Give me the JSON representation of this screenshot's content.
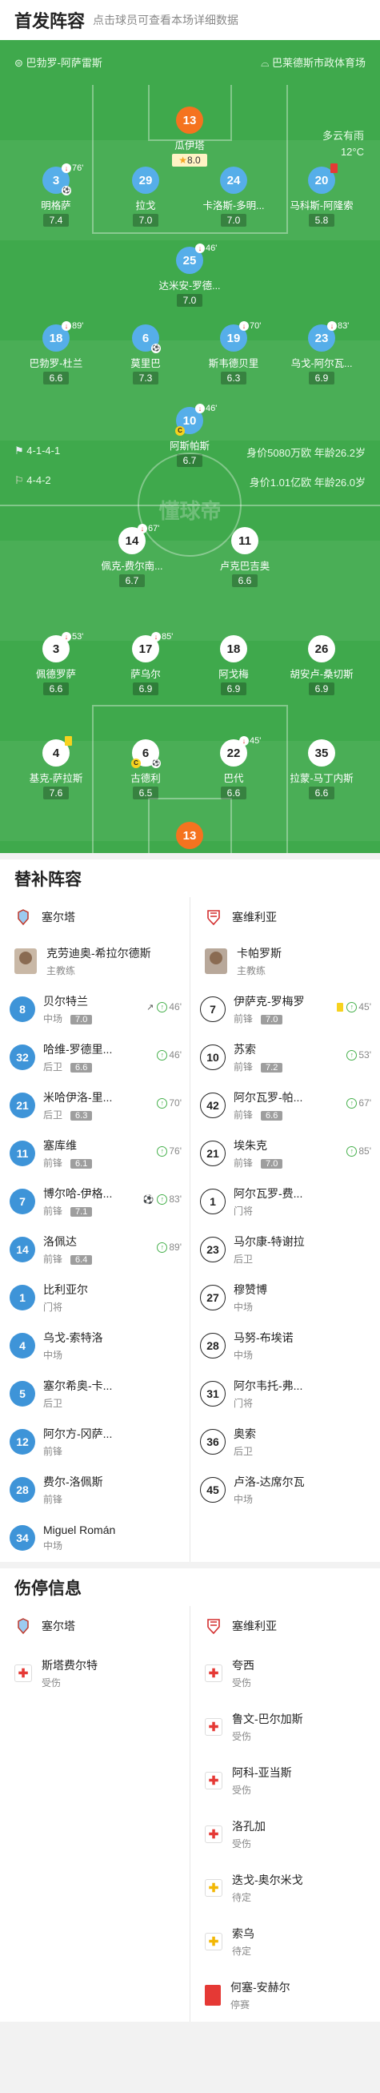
{
  "header": {
    "title": "首发阵容",
    "subtitle": "点击球员可查看本场详细数据"
  },
  "pitch": {
    "home_team": "巴勃罗-阿萨雷斯",
    "away_team": "巴莱德斯市政体育场",
    "weather": "多云有雨",
    "temperature": "12°C",
    "watermark": "懂球帝",
    "home_formation": "4-1-4-1",
    "home_value": "身价5080万欧 年龄26.2岁",
    "away_formation": "4-4-2",
    "away_value": "身价1.01亿欧 年龄26.0岁"
  },
  "home_players": [
    {
      "num": "13",
      "name": "瓜伊塔",
      "rating": "8.0",
      "star": true
    },
    {
      "num": "3",
      "name": "明格萨",
      "rating": "7.4",
      "sub": "76'"
    },
    {
      "num": "29",
      "name": "拉戈",
      "rating": "7.0"
    },
    {
      "num": "24",
      "name": "卡洛斯-多明...",
      "rating": "7.0"
    },
    {
      "num": "20",
      "name": "马科斯-阿隆索",
      "rating": "5.8"
    },
    {
      "num": "25",
      "name": "达米安-罗德...",
      "rating": "7.0",
      "sub": "46'"
    },
    {
      "num": "18",
      "name": "巴勃罗-杜兰",
      "rating": "6.6",
      "sub": "89'"
    },
    {
      "num": "6",
      "name": "莫里巴",
      "rating": "7.3"
    },
    {
      "num": "19",
      "name": "斯韦德贝里",
      "rating": "6.3",
      "sub": "70'"
    },
    {
      "num": "23",
      "name": "乌戈-阿尔瓦...",
      "rating": "6.9",
      "sub": "83'"
    },
    {
      "num": "10",
      "name": "阿斯帕斯",
      "rating": "6.7",
      "sub": "46'"
    }
  ],
  "away_players": [
    {
      "num": "14",
      "name": "佩克-费尔南...",
      "rating": "6.7",
      "sub": "67'"
    },
    {
      "num": "11",
      "name": "卢克巴吉奥",
      "rating": "6.6"
    },
    {
      "num": "3",
      "name": "佩德罗萨",
      "rating": "6.6",
      "sub": "53'"
    },
    {
      "num": "17",
      "name": "萨乌尔",
      "rating": "6.9",
      "sub": "85'"
    },
    {
      "num": "18",
      "name": "阿戈梅",
      "rating": "6.9"
    },
    {
      "num": "26",
      "name": "胡安卢-桑切斯",
      "rating": "6.9"
    },
    {
      "num": "4",
      "name": "基克-萨拉斯",
      "rating": "7.6"
    },
    {
      "num": "6",
      "name": "古德利",
      "rating": "6.5"
    },
    {
      "num": "22",
      "name": "巴代",
      "rating": "6.6",
      "sub": "45'"
    },
    {
      "num": "35",
      "name": "拉蒙-马丁内斯",
      "rating": "6.6"
    },
    {
      "num": "13",
      "name": "尼兰德",
      "rating": "6.3"
    }
  ],
  "subs_section": {
    "title": "替补阵容",
    "home_team": "塞尔塔",
    "away_team": "塞维利亚",
    "home_coach": {
      "name": "克劳迪奥-希拉尔德斯",
      "role": "主教练"
    },
    "away_coach": {
      "name": "卡帕罗斯",
      "role": "主教练"
    },
    "home": [
      {
        "num": "8",
        "name": "贝尔特兰",
        "pos": "中场",
        "rating": "7.0",
        "min": "46'",
        "icon": "↗"
      },
      {
        "num": "32",
        "name": "哈维-罗德里...",
        "pos": "后卫",
        "rating": "6.6",
        "min": "46'"
      },
      {
        "num": "21",
        "name": "米哈伊洛-里...",
        "pos": "后卫",
        "rating": "6.3",
        "min": "70'"
      },
      {
        "num": "11",
        "name": "塞库维",
        "pos": "前锋",
        "rating": "6.1",
        "min": "76'"
      },
      {
        "num": "7",
        "name": "博尔哈-伊格...",
        "pos": "前锋",
        "rating": "7.1",
        "min": "83'",
        "icon": "⚽"
      },
      {
        "num": "14",
        "name": "洛佩达",
        "pos": "前锋",
        "rating": "6.4",
        "min": "89'"
      },
      {
        "num": "1",
        "name": "比利亚尔",
        "pos": "门将"
      },
      {
        "num": "4",
        "name": "乌戈-索特洛",
        "pos": "中场"
      },
      {
        "num": "5",
        "name": "塞尔希奥-卡...",
        "pos": "后卫"
      },
      {
        "num": "12",
        "name": "阿尔方-冈萨...",
        "pos": "前锋"
      },
      {
        "num": "28",
        "name": "费尔-洛佩斯",
        "pos": "前锋"
      },
      {
        "num": "34",
        "name": "Miguel Román",
        "pos": "中场"
      }
    ],
    "away": [
      {
        "num": "7",
        "name": "伊萨克-罗梅罗",
        "pos": "前锋",
        "rating": "7.0",
        "min": "45'",
        "yellow": true
      },
      {
        "num": "10",
        "name": "苏索",
        "pos": "前锋",
        "rating": "7.2",
        "min": "53'"
      },
      {
        "num": "42",
        "name": "阿尔瓦罗-帕...",
        "pos": "前锋",
        "rating": "6.6",
        "min": "67'"
      },
      {
        "num": "21",
        "name": "埃朱克",
        "pos": "前锋",
        "rating": "7.0",
        "min": "85'"
      },
      {
        "num": "1",
        "name": "阿尔瓦罗-费...",
        "pos": "门将"
      },
      {
        "num": "23",
        "name": "马尔康-特谢拉",
        "pos": "后卫"
      },
      {
        "num": "27",
        "name": "穆赞博",
        "pos": "中场"
      },
      {
        "num": "28",
        "name": "马努-布埃诺",
        "pos": "中场"
      },
      {
        "num": "31",
        "name": "阿尔韦托-弗...",
        "pos": "门将"
      },
      {
        "num": "36",
        "name": "奥索",
        "pos": "后卫"
      },
      {
        "num": "45",
        "name": "卢洛-达席尔瓦",
        "pos": "中场"
      }
    ]
  },
  "injury_section": {
    "title": "伤停信息",
    "home_team": "塞尔塔",
    "away_team": "塞维利亚",
    "home": [
      {
        "name": "斯塔费尔特",
        "status": "受伤",
        "type": "injury"
      }
    ],
    "away": [
      {
        "name": "夸西",
        "status": "受伤",
        "type": "injury"
      },
      {
        "name": "鲁文-巴尔加斯",
        "status": "受伤",
        "type": "injury"
      },
      {
        "name": "阿科-亚当斯",
        "status": "受伤",
        "type": "injury"
      },
      {
        "name": "洛孔加",
        "status": "受伤",
        "type": "injury"
      },
      {
        "name": "迭戈-奥尔米戈",
        "status": "待定",
        "type": "doubt"
      },
      {
        "name": "索乌",
        "status": "待定",
        "type": "doubt"
      },
      {
        "name": "何塞-安赫尔",
        "status": "停赛",
        "type": "suspended"
      }
    ]
  },
  "colors": {
    "pitch": "#3fa94c",
    "home": "#56aee9",
    "keeper": "#f5731f",
    "sub_in": "#46b04c",
    "injury": "#e53935"
  }
}
